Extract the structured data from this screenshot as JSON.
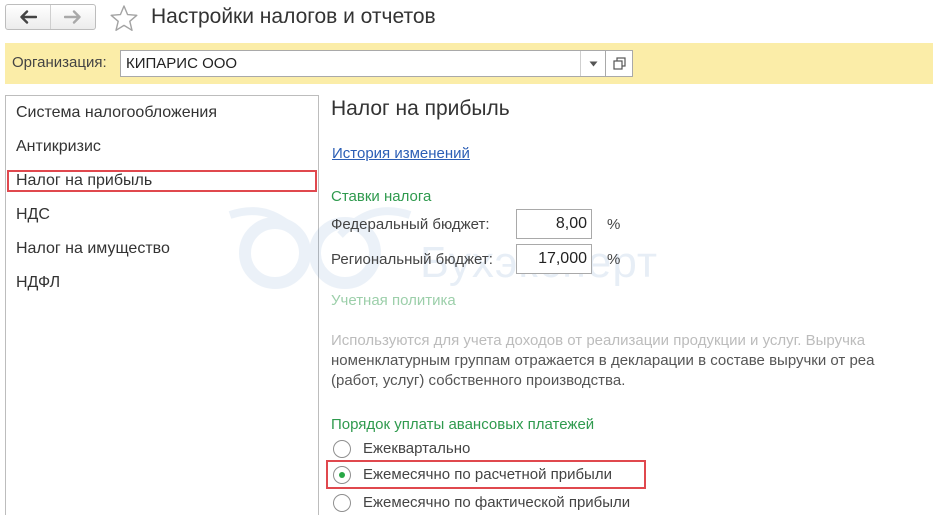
{
  "window": {
    "title": "Настройки налогов и отчетов",
    "back_icon": "arrow-left-icon",
    "forward_icon": "arrow-right-icon",
    "favorite_icon": "star-outline-icon"
  },
  "organization": {
    "label": "Организация:",
    "value": "КИПАРИС ООО",
    "dropdown_icon": "triangle-down-icon",
    "open_icon": "open-window-icon"
  },
  "sidebar": {
    "items": [
      {
        "label": "Система налогообложения"
      },
      {
        "label": "Антикризис"
      },
      {
        "label": "Налог на прибыль",
        "selected": true
      },
      {
        "label": "НДС"
      },
      {
        "label": "Налог на имущество"
      },
      {
        "label": "НДФЛ"
      }
    ]
  },
  "content": {
    "title": "Налог на прибыль",
    "history_link": "История изменений",
    "rates": {
      "heading": "Ставки налога",
      "federal_label": "Федеральный бюджет:",
      "federal_value": "8,00",
      "regional_label": "Региональный бюджет:",
      "regional_value": "17,000",
      "percent_sign": "%"
    },
    "policy": {
      "heading": "Учетная политика",
      "lines": [
        "Используются для учета доходов от реализации продукции и услуг. Выручка",
        "номенклатурным группам отражается в декларации в составе выручки от реа",
        "(работ, услуг) собственного производства."
      ]
    },
    "advance": {
      "heading": "Порядок уплаты авансовых платежей",
      "options": [
        {
          "label": "Ежеквартально",
          "checked": false
        },
        {
          "label": "Ежемесячно по расчетной прибыли",
          "checked": true
        },
        {
          "label": "Ежемесячно по фактической прибыли",
          "checked": false
        }
      ]
    }
  },
  "watermark": {
    "text": "Бухэксперт"
  },
  "colors": {
    "org_bar": "#fbeda8",
    "section_heading": "#2f9a4e",
    "link": "#2b5eb5",
    "highlight": "#e0484e",
    "radio_dot": "#28a745"
  }
}
